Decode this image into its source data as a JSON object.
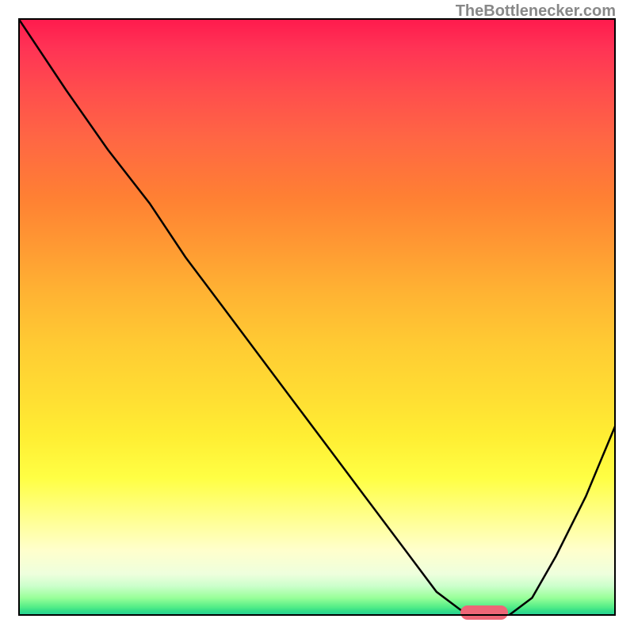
{
  "watermark": "TheBottlenecker.com",
  "chart_data": {
    "type": "line",
    "title": "",
    "xlabel": "",
    "ylabel": "",
    "xlim": [
      0,
      100
    ],
    "ylim": [
      0,
      100
    ],
    "background": "gradient-red-to-green-vertical",
    "series": [
      {
        "name": "bottleneck-curve",
        "x": [
          0,
          8,
          15,
          22,
          28,
          34,
          40,
          46,
          52,
          58,
          64,
          70,
          74,
          78,
          82,
          86,
          90,
          95,
          100
        ],
        "y": [
          100,
          88,
          78,
          69,
          60,
          52,
          44,
          36,
          28,
          20,
          12,
          4,
          1,
          0,
          0,
          3,
          10,
          20,
          32
        ]
      }
    ],
    "marker": {
      "name": "optimal-range",
      "x_start": 74,
      "x_end": 82,
      "y": 0.5,
      "color": "#ee6677"
    },
    "gradient_meaning": {
      "top_red": "high-bottleneck",
      "bottom_green": "no-bottleneck"
    }
  }
}
